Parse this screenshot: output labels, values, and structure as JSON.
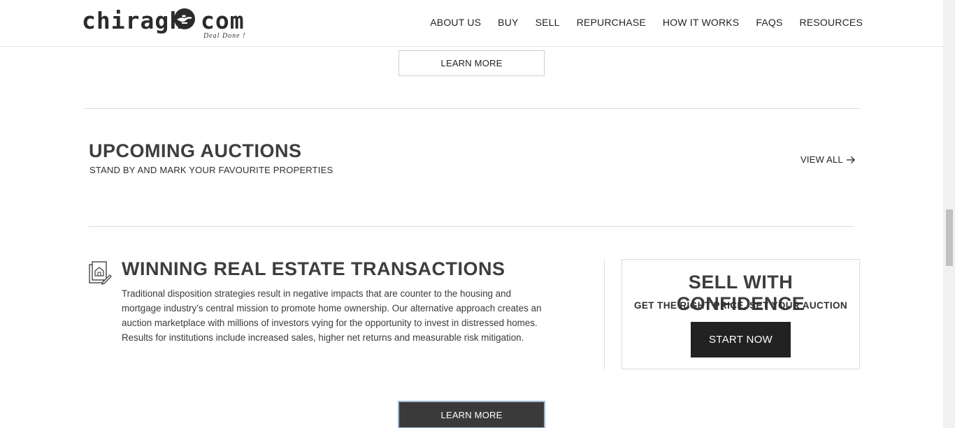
{
  "header": {
    "logo_left": "chiragh",
    "logo_right": "com",
    "tagline": "Deal Done !",
    "nav": [
      "ABOUT US",
      "BUY",
      "SELL",
      "REPURCHASE",
      "HOW IT WORKS",
      "FAQS",
      "RESOURCES"
    ]
  },
  "top_section": {
    "learn_more_label": "LEARN MORE"
  },
  "auctions": {
    "title": "UPCOMING AUCTIONS",
    "subtitle": "STAND BY AND MARK YOUR FAVOURITE PROPERTIES",
    "view_all_label": "VIEW ALL",
    "view_all_icon": "arrow-right-icon"
  },
  "winning": {
    "icon": "document-house-icon",
    "title": "WINNING REAL ESTATE TRANSACTIONS",
    "body_lines": [
      "Traditional disposition strategies result in negative impacts that are counter to the housing and",
      "mortgage industry’s central mission to promote home ownership. Our alternative approach creates an",
      "auction marketplace with millions of investors vying for the opportunity to invest in distressed homes.",
      "Results for institutions include increased sales, higher net returns and measurable risk mitigation."
    ]
  },
  "sell_card": {
    "title": "SELL WITH CONFIDENCE",
    "subtitle": "GET THE RIGHT PRICE, SET YOUR AUCTION",
    "button_label": "START NOW"
  },
  "bottom": {
    "learn_more_label": "LEARN MORE"
  },
  "colors": {
    "dark_button": "#222222",
    "text": "#3d3d3d",
    "focus_border": "#9fb6d8"
  }
}
